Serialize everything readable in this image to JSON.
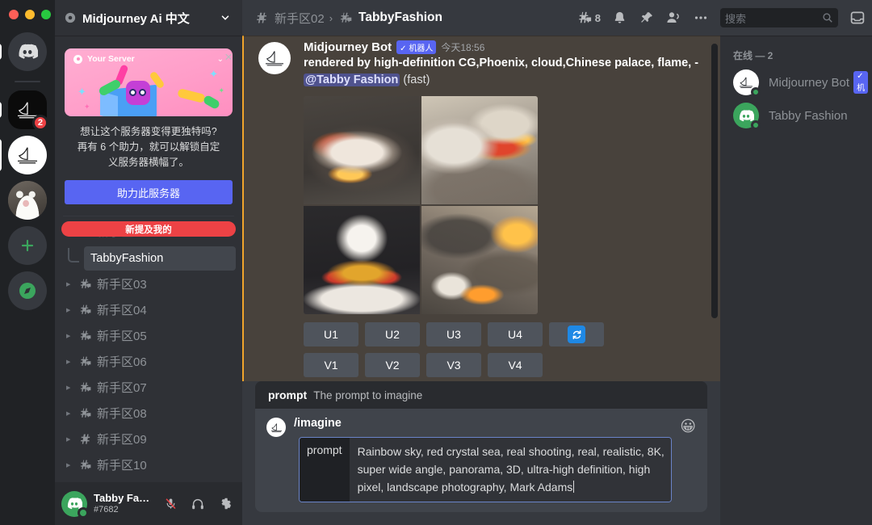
{
  "window": {
    "traffic_lights": [
      "close",
      "minimize",
      "maximize"
    ]
  },
  "rail": {
    "items": [
      {
        "name": "discord-home",
        "icon": "discord-logo",
        "state": "unread"
      },
      {
        "name": "midjourney-dark",
        "icon": "sailboat",
        "badge": "2",
        "state": "unread"
      },
      {
        "name": "midjourney-white",
        "icon": "sailboat",
        "state": "selected"
      },
      {
        "name": "cat-server",
        "icon": "cat-avatar",
        "state": "none"
      },
      {
        "name": "add-server",
        "icon": "plus",
        "label": "+",
        "state": "none"
      },
      {
        "name": "explore-servers",
        "icon": "compass",
        "state": "none"
      }
    ]
  },
  "sidebar": {
    "guild_name": "Midjourney Ai 中文",
    "boost": {
      "banner_title": "Your Server",
      "text_line1": "想让这个服务器变得更独特吗?",
      "text_line2": "再有 6 个助力，就可以解锁自定",
      "text_line3": "义服务器横幅了。",
      "button_label": "助力此服务器",
      "close_label": "×"
    },
    "mention_divider": "新提及我的",
    "active_thread": "TabbyFashion",
    "channels": [
      {
        "name": "新手区03",
        "icon": "forum-channel"
      },
      {
        "name": "新手区04",
        "icon": "forum-channel"
      },
      {
        "name": "新手区05",
        "icon": "forum-channel"
      },
      {
        "name": "新手区06",
        "icon": "forum-channel"
      },
      {
        "name": "新手区07",
        "icon": "forum-channel"
      },
      {
        "name": "新手区08",
        "icon": "forum-channel"
      },
      {
        "name": "新手区09",
        "icon": "text-channel"
      },
      {
        "name": "新手区10",
        "icon": "forum-channel"
      }
    ],
    "user_panel": {
      "name": "Tabby Fas...",
      "tag": "#7682",
      "mic_state": "muted",
      "deafen_state": "on",
      "settings_label": "gear"
    }
  },
  "topbar": {
    "breadcrumb_parent": "新手区02",
    "breadcrumb_sep": "›",
    "breadcrumb_current": "TabbyFashion",
    "thread_count": "8",
    "search_placeholder": "搜索"
  },
  "message": {
    "author": "Midjourney Bot",
    "bot_badge": "✓ 机器人",
    "timestamp": "今天18:56",
    "text_main": "rendered by high-definition CG,Phoenix, cloud,Chinese palace, flame, -",
    "mention": "@Tabby Fashion",
    "suffix": "(fast)",
    "upscale_buttons": [
      "U1",
      "U2",
      "U3",
      "U4"
    ],
    "reroll_button": "🔄",
    "variation_buttons": [
      "V1",
      "V2",
      "V3",
      "V4"
    ],
    "images": [
      {
        "alt": "fire dragon in grey cloud, dark backdrop"
      },
      {
        "alt": "red gold dragon coiling through sunlit clouds"
      },
      {
        "alt": "white flame phoenix crown above golden cloud throne"
      },
      {
        "alt": "golden phoenix soaring over smoky clouds"
      }
    ]
  },
  "composer": {
    "cmd_key": "prompt",
    "cmd_desc": "The prompt to imagine",
    "slash_command": "/imagine",
    "arg_key": "prompt",
    "arg_value": "Rainbow sky, red crystal sea, real shooting, real, realistic, 8K, super wide angle, panorama, 3D, ultra-high definition, high pixel, landscape photography, Mark Adams",
    "emoji_label": "😀"
  },
  "members": {
    "header": "在线 — 2",
    "list": [
      {
        "name": "Midjourney Bot",
        "badge": "✓ 机",
        "avatar": "sailboat",
        "status": "online"
      },
      {
        "name": "Tabby Fashion",
        "badge": "",
        "avatar": "discord-logo",
        "status": "online"
      }
    ]
  },
  "colors": {
    "accent": "#5865f2",
    "mention_bg": "#48423c",
    "mention_border": "#f0a42b",
    "danger": "#ed4245",
    "online": "#3ba55d",
    "refresh_blue": "#1e88e5"
  }
}
